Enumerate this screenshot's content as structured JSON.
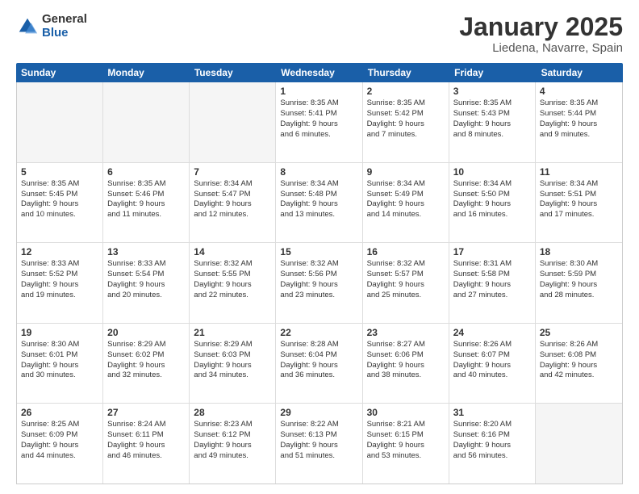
{
  "logo": {
    "general": "General",
    "blue": "Blue"
  },
  "title": "January 2025",
  "subtitle": "Liedena, Navarre, Spain",
  "weekdays": [
    "Sunday",
    "Monday",
    "Tuesday",
    "Wednesday",
    "Thursday",
    "Friday",
    "Saturday"
  ],
  "weeks": [
    [
      {
        "day": "",
        "lines": [],
        "empty": true
      },
      {
        "day": "",
        "lines": [],
        "empty": true
      },
      {
        "day": "",
        "lines": [],
        "empty": true
      },
      {
        "day": "1",
        "lines": [
          "Sunrise: 8:35 AM",
          "Sunset: 5:41 PM",
          "Daylight: 9 hours",
          "and 6 minutes."
        ]
      },
      {
        "day": "2",
        "lines": [
          "Sunrise: 8:35 AM",
          "Sunset: 5:42 PM",
          "Daylight: 9 hours",
          "and 7 minutes."
        ]
      },
      {
        "day": "3",
        "lines": [
          "Sunrise: 8:35 AM",
          "Sunset: 5:43 PM",
          "Daylight: 9 hours",
          "and 8 minutes."
        ]
      },
      {
        "day": "4",
        "lines": [
          "Sunrise: 8:35 AM",
          "Sunset: 5:44 PM",
          "Daylight: 9 hours",
          "and 9 minutes."
        ]
      }
    ],
    [
      {
        "day": "5",
        "lines": [
          "Sunrise: 8:35 AM",
          "Sunset: 5:45 PM",
          "Daylight: 9 hours",
          "and 10 minutes."
        ]
      },
      {
        "day": "6",
        "lines": [
          "Sunrise: 8:35 AM",
          "Sunset: 5:46 PM",
          "Daylight: 9 hours",
          "and 11 minutes."
        ]
      },
      {
        "day": "7",
        "lines": [
          "Sunrise: 8:34 AM",
          "Sunset: 5:47 PM",
          "Daylight: 9 hours",
          "and 12 minutes."
        ]
      },
      {
        "day": "8",
        "lines": [
          "Sunrise: 8:34 AM",
          "Sunset: 5:48 PM",
          "Daylight: 9 hours",
          "and 13 minutes."
        ]
      },
      {
        "day": "9",
        "lines": [
          "Sunrise: 8:34 AM",
          "Sunset: 5:49 PM",
          "Daylight: 9 hours",
          "and 14 minutes."
        ]
      },
      {
        "day": "10",
        "lines": [
          "Sunrise: 8:34 AM",
          "Sunset: 5:50 PM",
          "Daylight: 9 hours",
          "and 16 minutes."
        ]
      },
      {
        "day": "11",
        "lines": [
          "Sunrise: 8:34 AM",
          "Sunset: 5:51 PM",
          "Daylight: 9 hours",
          "and 17 minutes."
        ]
      }
    ],
    [
      {
        "day": "12",
        "lines": [
          "Sunrise: 8:33 AM",
          "Sunset: 5:52 PM",
          "Daylight: 9 hours",
          "and 19 minutes."
        ]
      },
      {
        "day": "13",
        "lines": [
          "Sunrise: 8:33 AM",
          "Sunset: 5:54 PM",
          "Daylight: 9 hours",
          "and 20 minutes."
        ]
      },
      {
        "day": "14",
        "lines": [
          "Sunrise: 8:32 AM",
          "Sunset: 5:55 PM",
          "Daylight: 9 hours",
          "and 22 minutes."
        ]
      },
      {
        "day": "15",
        "lines": [
          "Sunrise: 8:32 AM",
          "Sunset: 5:56 PM",
          "Daylight: 9 hours",
          "and 23 minutes."
        ]
      },
      {
        "day": "16",
        "lines": [
          "Sunrise: 8:32 AM",
          "Sunset: 5:57 PM",
          "Daylight: 9 hours",
          "and 25 minutes."
        ]
      },
      {
        "day": "17",
        "lines": [
          "Sunrise: 8:31 AM",
          "Sunset: 5:58 PM",
          "Daylight: 9 hours",
          "and 27 minutes."
        ]
      },
      {
        "day": "18",
        "lines": [
          "Sunrise: 8:30 AM",
          "Sunset: 5:59 PM",
          "Daylight: 9 hours",
          "and 28 minutes."
        ]
      }
    ],
    [
      {
        "day": "19",
        "lines": [
          "Sunrise: 8:30 AM",
          "Sunset: 6:01 PM",
          "Daylight: 9 hours",
          "and 30 minutes."
        ]
      },
      {
        "day": "20",
        "lines": [
          "Sunrise: 8:29 AM",
          "Sunset: 6:02 PM",
          "Daylight: 9 hours",
          "and 32 minutes."
        ]
      },
      {
        "day": "21",
        "lines": [
          "Sunrise: 8:29 AM",
          "Sunset: 6:03 PM",
          "Daylight: 9 hours",
          "and 34 minutes."
        ]
      },
      {
        "day": "22",
        "lines": [
          "Sunrise: 8:28 AM",
          "Sunset: 6:04 PM",
          "Daylight: 9 hours",
          "and 36 minutes."
        ]
      },
      {
        "day": "23",
        "lines": [
          "Sunrise: 8:27 AM",
          "Sunset: 6:06 PM",
          "Daylight: 9 hours",
          "and 38 minutes."
        ]
      },
      {
        "day": "24",
        "lines": [
          "Sunrise: 8:26 AM",
          "Sunset: 6:07 PM",
          "Daylight: 9 hours",
          "and 40 minutes."
        ]
      },
      {
        "day": "25",
        "lines": [
          "Sunrise: 8:26 AM",
          "Sunset: 6:08 PM",
          "Daylight: 9 hours",
          "and 42 minutes."
        ]
      }
    ],
    [
      {
        "day": "26",
        "lines": [
          "Sunrise: 8:25 AM",
          "Sunset: 6:09 PM",
          "Daylight: 9 hours",
          "and 44 minutes."
        ]
      },
      {
        "day": "27",
        "lines": [
          "Sunrise: 8:24 AM",
          "Sunset: 6:11 PM",
          "Daylight: 9 hours",
          "and 46 minutes."
        ]
      },
      {
        "day": "28",
        "lines": [
          "Sunrise: 8:23 AM",
          "Sunset: 6:12 PM",
          "Daylight: 9 hours",
          "and 49 minutes."
        ]
      },
      {
        "day": "29",
        "lines": [
          "Sunrise: 8:22 AM",
          "Sunset: 6:13 PM",
          "Daylight: 9 hours",
          "and 51 minutes."
        ]
      },
      {
        "day": "30",
        "lines": [
          "Sunrise: 8:21 AM",
          "Sunset: 6:15 PM",
          "Daylight: 9 hours",
          "and 53 minutes."
        ]
      },
      {
        "day": "31",
        "lines": [
          "Sunrise: 8:20 AM",
          "Sunset: 6:16 PM",
          "Daylight: 9 hours",
          "and 56 minutes."
        ]
      },
      {
        "day": "",
        "lines": [],
        "empty": true
      }
    ]
  ]
}
